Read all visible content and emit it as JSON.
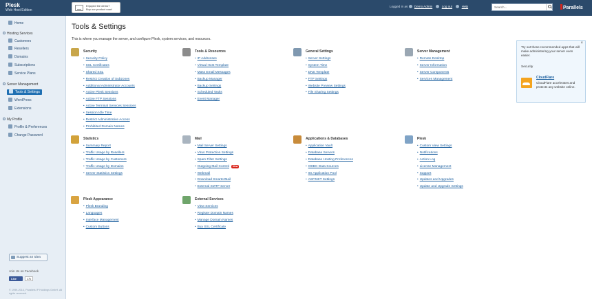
{
  "header": {
    "product": "Plesk",
    "edition": "Web Host Edition",
    "promo_line1": "Enjoyed the demo?",
    "promo_line2": "Buy our product now!",
    "logged_in_as": "Logged in as",
    "user": "Demo Admin",
    "logout": "Log out",
    "help": "Help",
    "search_placeholder": "Search...",
    "vendor": "Parallels"
  },
  "sidebar": {
    "home": "Home",
    "hosting_services": "Hosting Services",
    "customers": "Customers",
    "resellers": "Resellers",
    "domains": "Domains",
    "subscriptions": "Subscriptions",
    "service_plans": "Service Plans",
    "server_management": "Server Management",
    "tools_settings": "Tools & Settings",
    "wordpress": "WordPress",
    "extensions": "Extensions",
    "my_profile": "My Profile",
    "profile_preferences": "Profile & Preferences",
    "change_password": "Change Password",
    "suggest_idea": "Suggest an Idea",
    "join_facebook": "Join Us on Facebook",
    "fb_like": "Like",
    "fb_count": "17k",
    "copyright": "© 1999-2014, Parallels IP Holdings GmbH. All rights reserved."
  },
  "page": {
    "title": "Tools & Settings",
    "intro": "This is where you manage the server, and configure Plesk, system services, and resources."
  },
  "sections": {
    "security": {
      "title": "Security",
      "links": [
        "Security Policy",
        "SSL Certificates",
        "Shared SSL",
        "Restrict Creation of Subzones",
        "Additional Administrator Accounts",
        "Active Plesk Sessions",
        "Active FTP Sessions",
        "Active Terminal Services Sessions",
        "Session Idle Time",
        "Restrict Administrative Access",
        "Prohibited Domain Names"
      ]
    },
    "tools_resources": {
      "title": "Tools & Resources",
      "links": [
        "IP Addresses",
        "Virtual Host Template",
        "Mass Email Messages",
        "Backup Manager",
        "Backup Settings",
        "Scheduled Tasks",
        "Event Manager"
      ]
    },
    "general_settings": {
      "title": "General Settings",
      "links": [
        "Server Settings",
        "System Time",
        "DNS Template",
        "FTP Settings",
        "Website Preview Settings",
        "File Sharing Settings"
      ]
    },
    "server_mgmt": {
      "title": "Server Management",
      "links": [
        "Remote Desktop",
        "Server Information",
        "Server Components",
        "Services Management"
      ]
    },
    "statistics": {
      "title": "Statistics",
      "links": [
        "Summary Report",
        "Traffic Usage by Resellers",
        "Traffic Usage by Customers",
        "Traffic Usage by Domains",
        "Server Statistics Settings"
      ]
    },
    "mail": {
      "title": "Mail",
      "links": [
        "Mail Server Settings",
        "Virus Protection Settings",
        "Spam Filter Settings",
        "Outgoing Mail Control",
        "Webmail",
        "Download SmarterMail",
        "External SMTP Server"
      ],
      "new_badge": "New"
    },
    "apps_db": {
      "title": "Applications & Databases",
      "links": [
        "Application Vault",
        "Database Servers",
        "Database Hosting Preferences",
        "ODBC Data Sources",
        "IIS Application Pool",
        "ASP.NET Settings"
      ]
    },
    "plesk": {
      "title": "Plesk",
      "links": [
        "Custom View Settings",
        "Notifications",
        "Action Log",
        "License Management",
        "Support",
        "Updates and Upgrades",
        "Update and Upgrade Settings"
      ]
    },
    "appearance": {
      "title": "Plesk Appearance",
      "links": [
        "Plesk Branding",
        "Languages",
        "Interface Management",
        "Custom Buttons"
      ]
    },
    "external": {
      "title": "External Services",
      "links": [
        "View Services",
        "Register Domain Names",
        "Manage Domain Names",
        "Buy SSL Certificate"
      ]
    }
  },
  "tips": {
    "close": "×",
    "text": "Try out these recommended apps that will make administering your server even easier.",
    "section": "Security",
    "app_name": "CloudFlare",
    "app_desc": "CloudFlare accelerates and protects any website online."
  },
  "colors": {
    "topbar": "#2b4a6b",
    "link": "#1a5e9e",
    "active_nav": "#1f6fb2",
    "new_badge": "#d9261c"
  }
}
